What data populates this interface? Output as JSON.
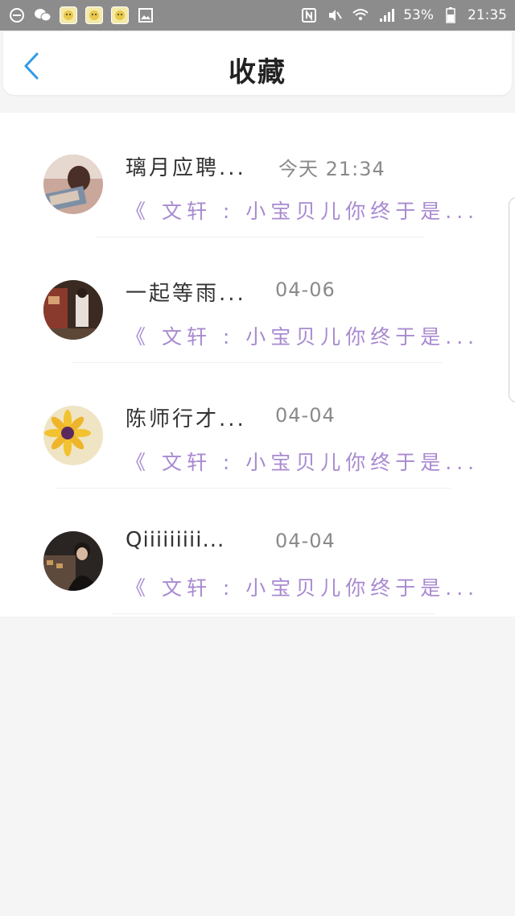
{
  "statusbar": {
    "battery": "53%",
    "time": "21:35"
  },
  "header": {
    "title": "收藏"
  },
  "favorites": [
    {
      "name": "璃月应聘...",
      "time": "今天 21:34",
      "preview": "《 文轩 : 小宝贝儿你终于是..."
    },
    {
      "name": "一起等雨...",
      "time": "04-06",
      "preview": "《 文轩 : 小宝贝儿你终于是..."
    },
    {
      "name": "陈师行才...",
      "time": "04-04",
      "preview": "《 文轩 : 小宝贝儿你终于是..."
    },
    {
      "name": "Qiiiiiiiii...",
      "time": "04-04",
      "preview": "《 文轩 : 小宝贝儿你终于是..."
    }
  ],
  "colors": {
    "accent": "#2f9be8",
    "preview_text": "#a88ad0",
    "statusbar_bg": "#8c8c8c"
  }
}
